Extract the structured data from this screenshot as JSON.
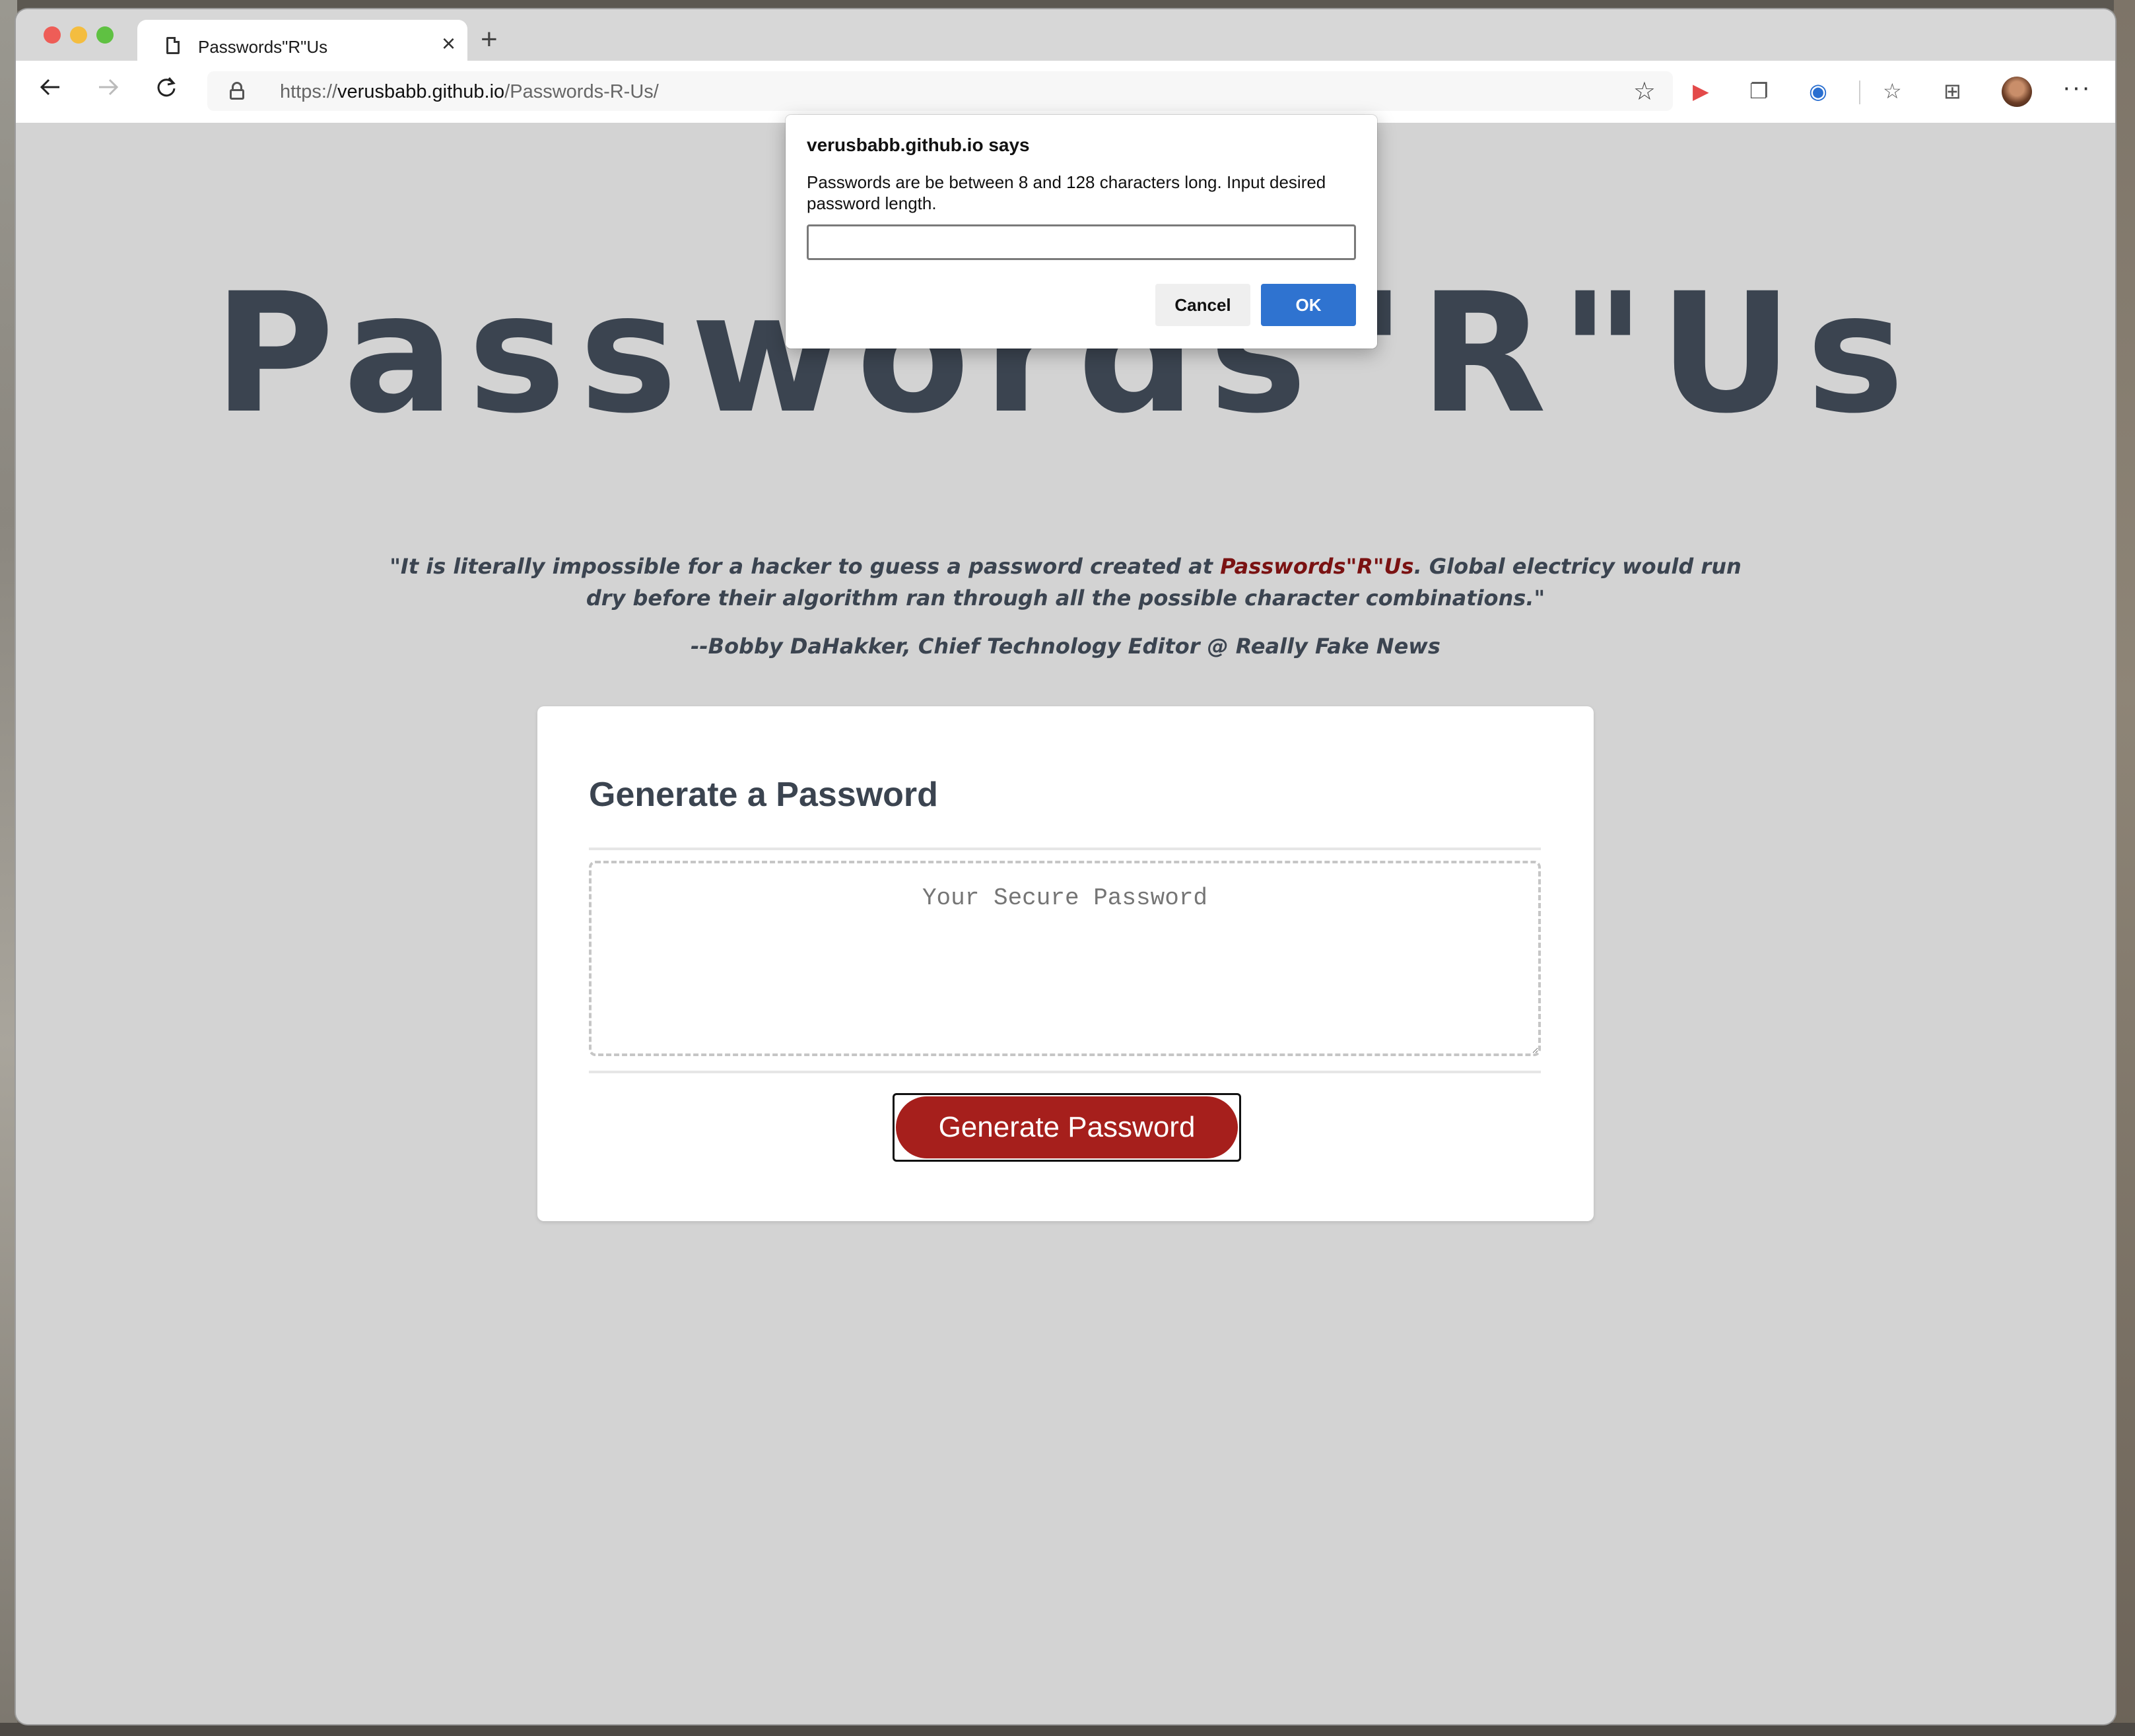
{
  "browser": {
    "tab_title": "Passwords\"R\"Us",
    "tab_close": "×",
    "new_tab": "+",
    "url_scheme": "https://",
    "url_host": "verusbabb.github.io",
    "url_path": "/Passwords-R-Us/"
  },
  "page": {
    "hero_title": "Passwords\"R\"Us",
    "quote_before": "\"It is literally impossible for a hacker to guess a password created at ",
    "quote_brand": "Passwords\"R\"Us",
    "quote_after": ". Global electricy would run dry before their algorithm ran through all the possible character combinations.\"",
    "attribution": "--Bobby DaHakker, Chief Technology Editor @ Really Fake News",
    "card": {
      "title": "Generate a Password",
      "password_placeholder": "Your Secure Password",
      "password_value": "",
      "button_label": "Generate Password"
    }
  },
  "dialog": {
    "title": "verusbabb.github.io says",
    "message": "Passwords are be between 8 and 128 characters long. Input desired password length.",
    "input_value": "",
    "cancel_label": "Cancel",
    "ok_label": "OK"
  },
  "colors": {
    "page_background": "#d3d3d3",
    "heading_text": "#3b4450",
    "brand_accent": "#7a1212",
    "button_red": "#a61f1c",
    "dialog_ok_blue": "#2f73d0"
  },
  "icons": {
    "tab": "page-icon",
    "back": "arrow-left-icon",
    "forward": "arrow-right-icon",
    "reload": "reload-icon",
    "lock": "lock-icon",
    "favorite": "star-icon",
    "extensions": [
      "extension-red-icon",
      "extension-copy-icon",
      "extension-password-icon"
    ],
    "favorites": "favorites-list-icon",
    "collections": "collections-icon",
    "profile": "avatar",
    "menu": "more-icon"
  }
}
